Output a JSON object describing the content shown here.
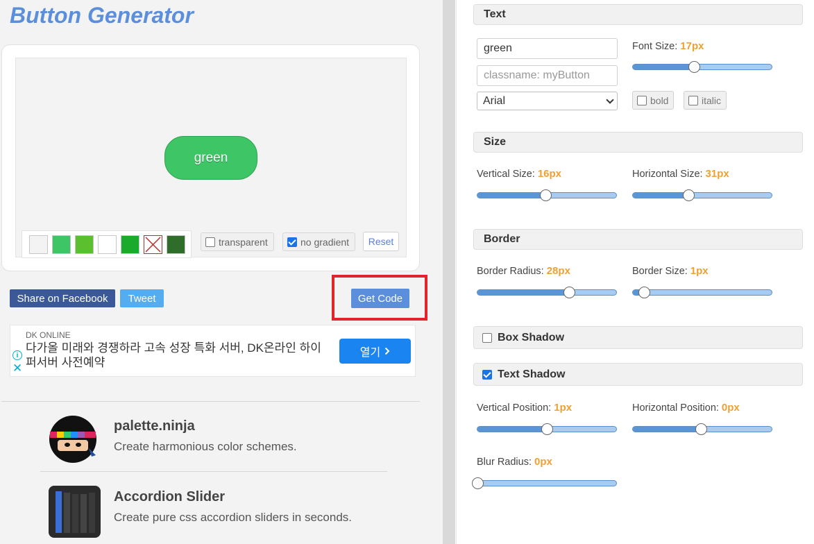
{
  "app": {
    "title": "Button Generator"
  },
  "preview": {
    "button_label": "green",
    "swatches": [
      {
        "name": "light-gray",
        "color": "#f3f3f3"
      },
      {
        "name": "green",
        "color": "#3ec566"
      },
      {
        "name": "lime-green",
        "color": "#5cc02e"
      },
      {
        "name": "white",
        "color": "#ffffff"
      },
      {
        "name": "bright-green",
        "color": "#1aab2c"
      },
      {
        "name": "none",
        "color": "#ffffff"
      },
      {
        "name": "dark-green",
        "color": "#2f6d2a"
      }
    ],
    "transparent_label": "transparent",
    "transparent_checked": false,
    "no_gradient_label": "no gradient",
    "no_gradient_checked": true,
    "reset_label": "Reset"
  },
  "share": {
    "facebook_label": "Share on Facebook",
    "tweet_label": "Tweet"
  },
  "get_code_label": "Get Code",
  "ad": {
    "sponsor": "DK ONLINE",
    "text": "다가올 미래와 경쟁하라 고속 성장 특화 서버, DK온라인 하이퍼서버 사전예약",
    "cta": "열기"
  },
  "promos": [
    {
      "title": "palette.ninja",
      "desc": "Create harmonious color schemes."
    },
    {
      "title": "Accordion Slider",
      "desc": "Create pure css accordion sliders in seconds."
    }
  ],
  "settings": {
    "text": {
      "heading": "Text",
      "value": "green",
      "classname_placeholder": "classname: myButton",
      "font_family": "Arial",
      "font_size_label": "Font Size:",
      "font_size_value": "17px",
      "bold_label": "bold",
      "italic_label": "italic",
      "bold_checked": false,
      "italic_checked": false
    },
    "size": {
      "heading": "Size",
      "vertical_label": "Vertical Size:",
      "vertical_value": "16px",
      "horizontal_label": "Horizontal Size:",
      "horizontal_value": "31px"
    },
    "border": {
      "heading": "Border",
      "radius_label": "Border Radius:",
      "radius_value": "28px",
      "size_label": "Border Size:",
      "size_value": "1px"
    },
    "box_shadow": {
      "heading": "Box Shadow",
      "checked": false
    },
    "text_shadow": {
      "heading": "Text Shadow",
      "checked": true,
      "vpos_label": "Vertical Position:",
      "vpos_value": "1px",
      "hpos_label": "Horizontal Position:",
      "hpos_value": "0px",
      "blur_label": "Blur Radius:",
      "blur_value": "0px"
    }
  },
  "slider_levels": {
    "font_size": 0.44,
    "vertical_size": 0.49,
    "horizontal_size": 0.4,
    "border_radius": 0.66,
    "border_size": 0.08,
    "text_shadow_vpos": 0.5,
    "text_shadow_hpos": 0.49,
    "blur_radius": 0.0
  },
  "colors": {
    "accent": "#5b8fdb",
    "value_orange": "#f0a030",
    "demo_button": "#3ec566",
    "highlight_red": "#e3232c"
  }
}
